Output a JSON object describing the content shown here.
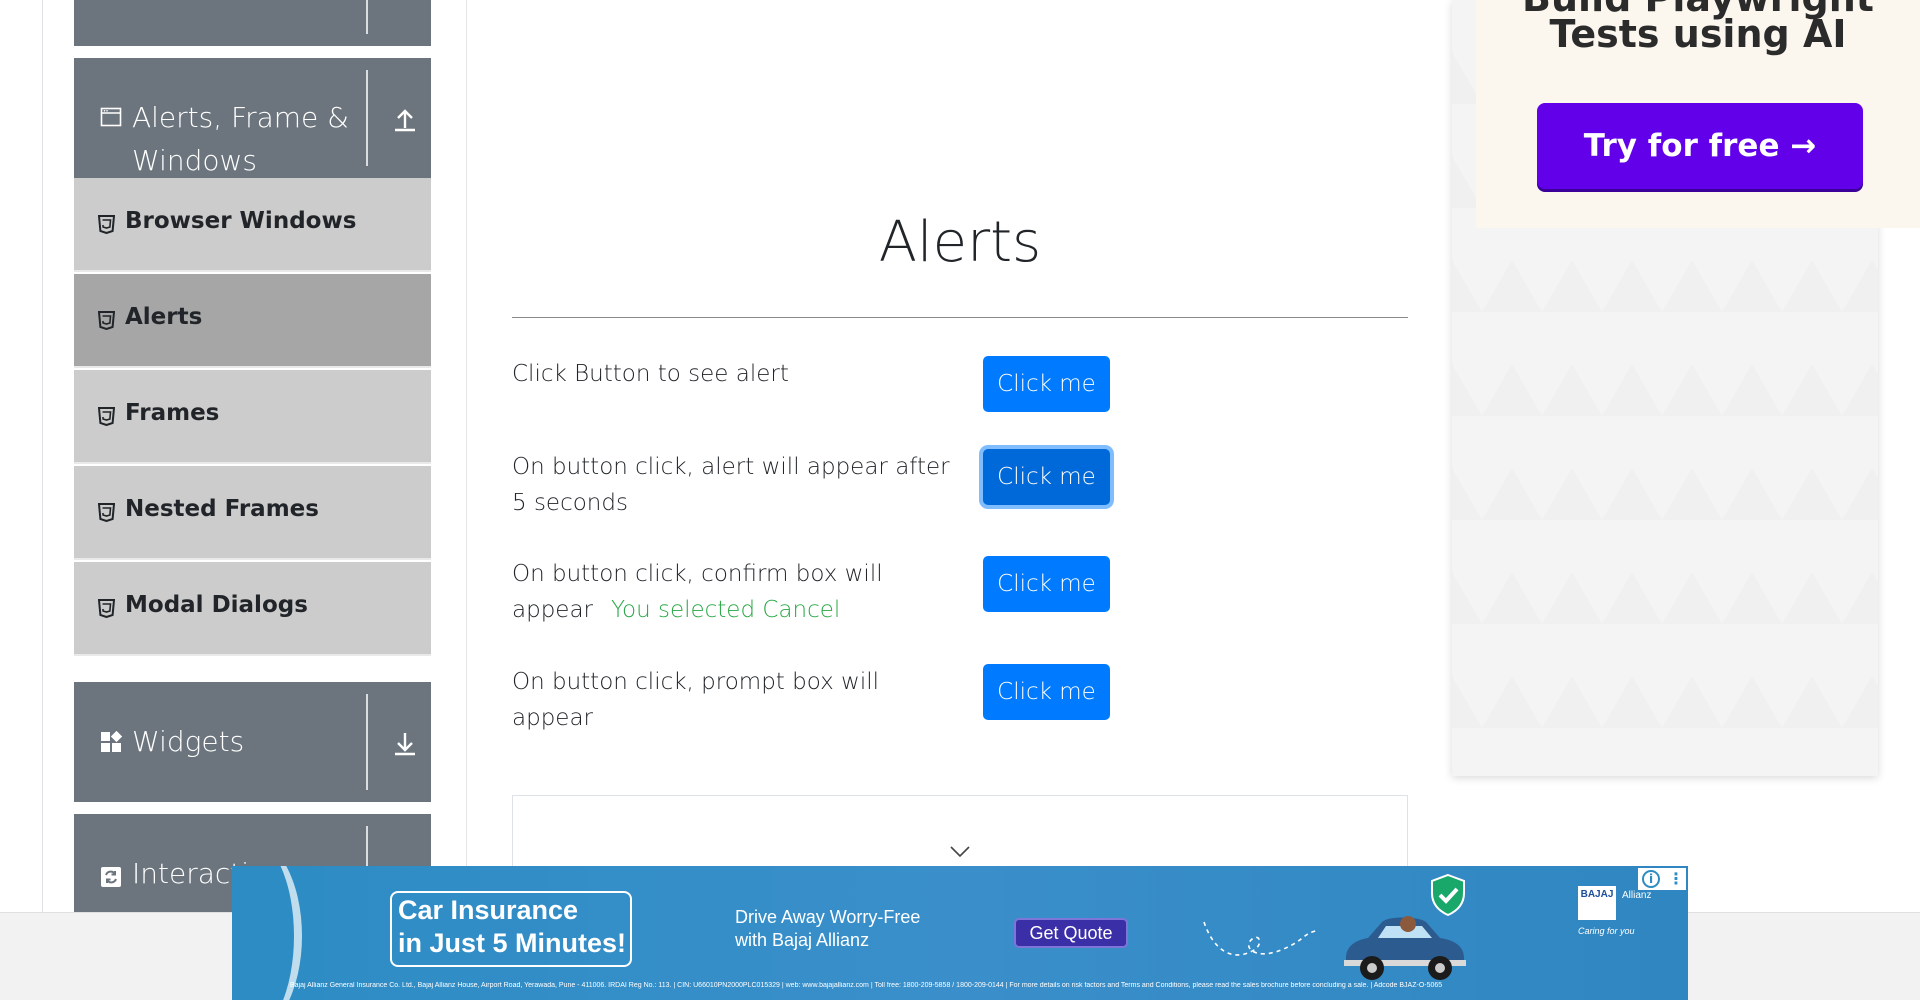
{
  "sidebar": {
    "alerts_group": {
      "title_line1": "Alerts, Frame &",
      "title_line2": "Windows",
      "icon": "window-icon",
      "arrow": "upload-arrow-icon"
    },
    "items": [
      {
        "label": "Browser Windows",
        "icon": "html5-icon",
        "active": false
      },
      {
        "label": "Alerts",
        "icon": "html5-icon",
        "active": true
      },
      {
        "label": "Frames",
        "icon": "html5-icon",
        "active": false
      },
      {
        "label": "Nested Frames",
        "icon": "html5-icon",
        "active": false
      },
      {
        "label": "Modal Dialogs",
        "icon": "html5-icon",
        "active": false
      }
    ],
    "widgets_group": {
      "title": "Widgets",
      "icon": "widgets-icon",
      "arrow": "download-arrow-icon"
    },
    "interactions_group": {
      "title": "Interacti",
      "icon": "interactions-icon"
    }
  },
  "main": {
    "title": "Alerts",
    "rows": [
      {
        "label": "Click Button to see alert",
        "button": "Click me"
      },
      {
        "label": "On button click, alert will appear after 5 seconds",
        "button": "Click me"
      },
      {
        "label": "On button click, confirm box will appear",
        "result": "You selected Cancel",
        "button": "Click me"
      },
      {
        "label": "On button click, prompt box will appear",
        "button": "Click me"
      }
    ]
  },
  "right_ad": {
    "headline_cut": "Build Playwright",
    "headline": "Tests using AI",
    "cta": "Try for free →",
    "cta_color": "#6200ea"
  },
  "bottom_ad": {
    "headline": "Car Insurance\nin Just 5 Minutes!",
    "tagline": "Drive Away Worry-Free\nwith Bajaj Allianz",
    "cta": "Get Quote",
    "logo_text": "BAJAJ",
    "logo_partner": "Allianz",
    "logo_slogan": "Caring for you",
    "fine_print": "Bajaj Allianz General Insurance Co. Ltd., Bajaj Allianz House, Airport Road, Yerawada, Pune - 411006. IRDAI Reg No.: 113. | CIN: U66010PN2000PLC015329 | web: www.bajajallianz.com | Toll free: 1800-209-5858 / 1800-209-0144 | For more details on risk factors and Terms and Conditions, please read the sales brochure before concluding a sale. | Adcode BJAZ-O-5065",
    "background": "#2d8cc4"
  },
  "colors": {
    "primary": "#007bff",
    "sidebar_header": "#6c757d",
    "menu_item": "#cccccc",
    "menu_active": "#a6a6a6",
    "result_text": "#28a745"
  }
}
